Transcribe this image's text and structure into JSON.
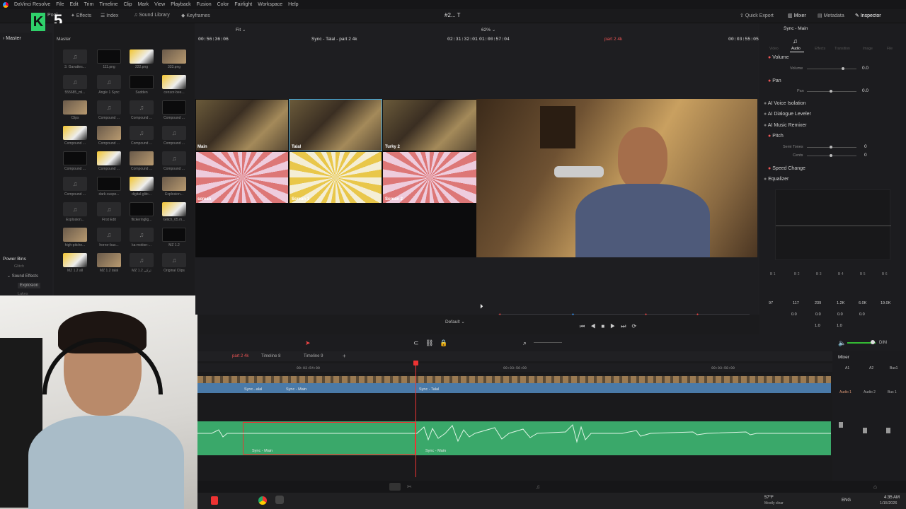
{
  "menu": {
    "app": "DaVinci Resolve",
    "items": [
      "File",
      "Edit",
      "Trim",
      "Timeline",
      "Clip",
      "Mark",
      "View",
      "Playback",
      "Fusion",
      "Color",
      "Fairlight",
      "Workspace",
      "Help"
    ]
  },
  "toolbar": {
    "media_pool": "Pool",
    "effects": "Effects",
    "index": "Index",
    "sound_library": "Sound Library",
    "keyframes": "Keyframes",
    "project_title": "#2... T",
    "quick_export": "Quick Export",
    "mixer": "Mixer",
    "metadata": "Metadata",
    "inspector": "Inspector"
  },
  "overlay_logo": {
    "letter": "K",
    "number": "5"
  },
  "media_pool": {
    "bin_title": "Master",
    "tree_root": "Master",
    "power_bins_title": "Power Bins",
    "power_bins": [
      "Glitch",
      "Sound Effects",
      "Explosion",
      "Lakes"
    ],
    "clips": [
      [
        "3. Gavattes...",
        "111.png",
        "222.png",
        "333.png"
      ],
      [
        "555685_ml...",
        "Angle 1 Sync",
        "Sudden",
        "censor-bee..."
      ],
      [
        "Clips",
        "Compound ...",
        "Compound ...",
        "Compound ..."
      ],
      [
        "Compound ...",
        "Compound ...",
        "Compound ...",
        "Compound ..."
      ],
      [
        "Compound ...",
        "Compound ...",
        "Compound ...",
        "Compound ..."
      ],
      [
        "Compound ...",
        "dark-suspe...",
        "digital-glitc...",
        "Explosion..."
      ],
      [
        "Explosion...",
        "First Edit",
        "flickeringlig...",
        "Glitch_05.m..."
      ],
      [
        "high-pitche...",
        "horror-bas...",
        "ka-motion-...",
        "MZ 1.2"
      ],
      [
        "MZ 1.2 all",
        "MZ 1.2 talal",
        "MZ 1.2 تركي",
        "Original Clips"
      ]
    ]
  },
  "viewer": {
    "source_tc": "00:56:36:06",
    "fit": "Fit",
    "clip_name": "Sync - Talal - part 2 4k",
    "duration_tc": "02:31:32:01",
    "timeline_tc": "01:00:57:04",
    "zoom": "62%",
    "timeline_name": "part 2 4k",
    "record_tc": "00:03:55:05",
    "angles": [
      "Main",
      "Talal",
      "Turky 2",
      "screan",
      "Screan 1",
      "Screan 2"
    ],
    "mode": "Default"
  },
  "inspector": {
    "clip_title": "Sync - Main",
    "tabs": [
      "Video",
      "Audio",
      "Effects",
      "Transition",
      "Image",
      "File"
    ],
    "active_tab": "Audio",
    "volume_label": "Volume",
    "volume_sub": "Volume",
    "volume_value": "0.0",
    "pan_label": "Pan",
    "pan_sub": "Pan",
    "pan_value": "0.0",
    "ai_voice_isolation": "AI Voice Isolation",
    "ai_dialogue_leveler": "AI Dialogue Leveler",
    "ai_music_remixer": "AI Music Remixer",
    "pitch_label": "Pitch",
    "semi_tones": "Semi Tones",
    "semi_value": "0",
    "cents": "Cents",
    "cents_value": "0",
    "speed_change": "Speed Change",
    "equalizer": "Equalizer",
    "eq_bands": [
      "B 1",
      "B 2",
      "B 3",
      "B 4",
      "B 5",
      "B 6"
    ],
    "eq_freqs": [
      "97",
      "117",
      "239",
      "1.2K",
      "6.0K",
      "19.0K"
    ],
    "eq_gains": [
      "0.0",
      "0.0",
      "0.0",
      "0.0"
    ],
    "eq_q": [
      "1.0",
      "1.0"
    ]
  },
  "timeline": {
    "tabs": [
      "part 2 4k",
      "Timeline 8",
      "Timeline 9"
    ],
    "ruler": [
      "00:03:54:00",
      "00:03:56:00",
      "00:03:58:00"
    ],
    "video_clips": [
      "Sync...alal",
      "Sync - Main",
      "Sync - Talal"
    ],
    "audio_clips": [
      "Sync - Main",
      "Sync - Main"
    ],
    "mixer_title": "Mixer",
    "mixer_channels": [
      "A1",
      "A2",
      "Bus1"
    ],
    "mixer_names": [
      "Audio 1",
      "Audio 2",
      "Bus 1"
    ],
    "dim": "DIM"
  },
  "taskbar": {
    "temp": "57°F",
    "weather": "Mostly clear",
    "lang": "ENG",
    "time": "4:35 AM",
    "date": "1/15/2026"
  }
}
